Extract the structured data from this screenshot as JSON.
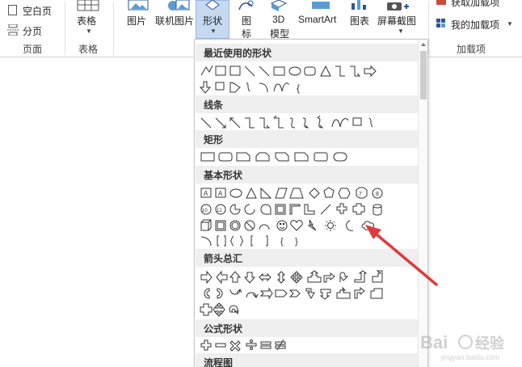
{
  "ribbon": {
    "blank_page": "空白页",
    "page_break": "分页",
    "group_pages": "页面",
    "table": "表格",
    "group_table": "表格",
    "picture": "图片",
    "online_picture": "联机图片",
    "shapes": "形状",
    "icons_top": "图",
    "icons_bottom": "标",
    "model_top": "3D",
    "model_bottom": "模型",
    "smartart": "SmartArt",
    "chart": "图表",
    "screenshot": "屏幕截图",
    "get_addins": "获取加载项",
    "my_addins": "我的加载项",
    "group_addins": "加载项"
  },
  "panel": {
    "sections": [
      {
        "label": "最近使用的形状"
      },
      {
        "label": "线条"
      },
      {
        "label": "矩形"
      },
      {
        "label": "基本形状"
      },
      {
        "label": "箭头总汇"
      },
      {
        "label": "公式形状"
      },
      {
        "label": "流程图"
      }
    ],
    "textbox_glyph": "A",
    "brace_glyph": "{",
    "brace_close_glyph": "}",
    "num7": "7",
    "num8": "8",
    "num10": "10",
    "num12": "12"
  },
  "colors": {
    "accent": "#2b579a",
    "active_tab": "#c5d9f1",
    "annotation": "#e03a3a",
    "section_bg": "#efefef"
  }
}
